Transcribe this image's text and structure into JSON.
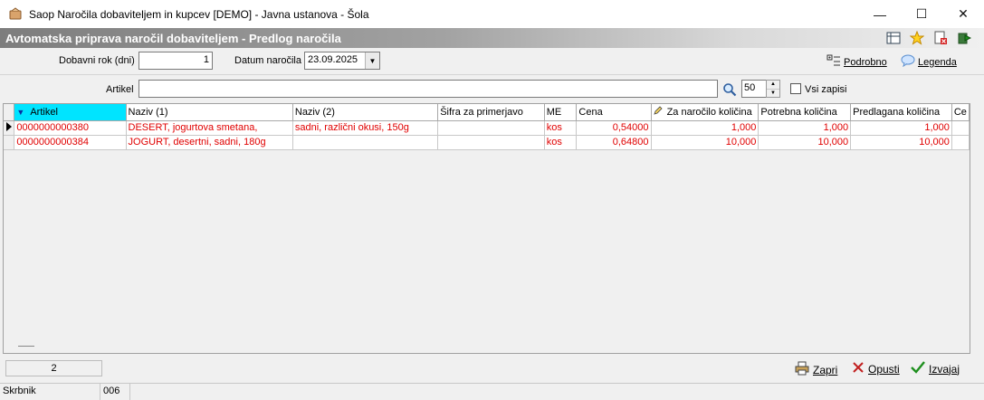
{
  "window": {
    "title": "Saop Naročila dobaviteljem in kupcev [DEMO] - Javna ustanova - Šola",
    "minimize": "—",
    "maximize": "☐",
    "close": "✕"
  },
  "caption": {
    "title": "Avtomatska priprava naročil dobaviteljem - Predlog naročila"
  },
  "filters": {
    "dobavni_rok_label": "Dobavni rok (dni)",
    "dobavni_rok_value": "1",
    "datum_label": "Datum naročila",
    "datum_value": "23.09.2025",
    "podrobno_label": "Podrobno",
    "legenda_label": "Legenda",
    "artikel_label": "Artikel",
    "artikel_value": "",
    "count_value": "50",
    "vsi_zapisi_label": "Vsi zapisi"
  },
  "grid": {
    "columns": [
      "Artikel",
      "Naziv (1)",
      "Naziv (2)",
      "Šifra za primerjavo",
      "ME",
      "Cena",
      "Za naročilo količina",
      "Potrebna količina",
      "Predlagana količina",
      "Ce"
    ],
    "rows": [
      {
        "artikel": "0000000000380",
        "naziv1": "DESERT, jogurtova smetana,",
        "naziv2": "sadni, različni okusi, 150g",
        "sifra": "",
        "me": "kos",
        "cena": "0,54000",
        "za_narocilo": "1,000",
        "potrebna": "1,000",
        "predlagana": "1,000",
        "ce": ""
      },
      {
        "artikel": "0000000000384",
        "naziv1": "JOGURT, desertni, sadni, 180g",
        "naziv2": "",
        "sifra": "",
        "me": "kos",
        "cena": "0,64800",
        "za_narocilo": "10,000",
        "potrebna": "10,000",
        "predlagana": "10,000",
        "ce": ""
      }
    ]
  },
  "footer": {
    "record_count": "2",
    "zapri_label": "Zapri",
    "opusti_label": "Opusti",
    "izvajaj_label": "Izvajaj"
  },
  "statusbar": {
    "user": "Skrbnik",
    "code": "006"
  },
  "colors": {
    "sorted_header": "#00e4ff",
    "row_text": "#e00000"
  }
}
